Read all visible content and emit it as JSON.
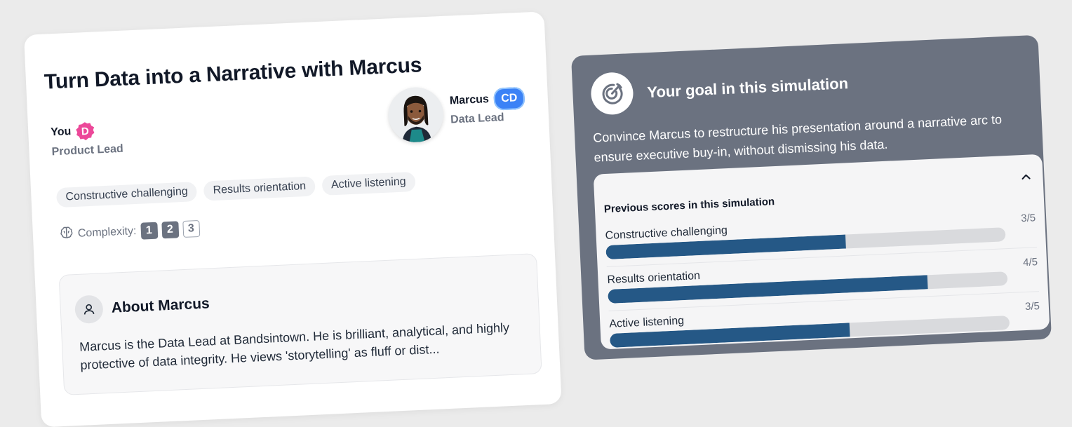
{
  "simulation": {
    "title": "Turn Data into a Narrative with Marcus",
    "you": {
      "name": "You",
      "badge": "D",
      "role": "Product Lead"
    },
    "partner": {
      "name": "Marcus",
      "badge": "CD",
      "role": "Data Lead"
    },
    "skills": [
      "Constructive challenging",
      "Results orientation",
      "Active listening"
    ],
    "complexity": {
      "label": "Complexity:",
      "levels": [
        "1",
        "2",
        "3"
      ],
      "current": 2
    }
  },
  "about": {
    "title": "About Marcus",
    "text": "Marcus is the Data Lead at Bandsintown. He is brilliant, analytical, and highly protective of data integrity. He views 'storytelling' as fluff or dist..."
  },
  "goal": {
    "title": "Your goal in this simulation",
    "text": "Convince Marcus to restructure his presentation around a narrative arc to ensure executive buy-in, without dismissing his data."
  },
  "scores": {
    "title": "Previous scores in this simulation",
    "items": [
      {
        "label": "Constructive challenging",
        "score": 3,
        "max": 5,
        "text": "3/5",
        "fill_percent": 60
      },
      {
        "label": "Results orientation",
        "score": 4,
        "max": 5,
        "text": "4/5",
        "fill_percent": 80
      },
      {
        "label": "Active listening",
        "score": 3,
        "max": 5,
        "text": "3/5",
        "fill_percent": 60
      }
    ]
  },
  "colors": {
    "you_badge": "#ec4899",
    "partner_badge": "#3b82f6",
    "goal_card": "#6b7280",
    "score_fill": "#255886"
  },
  "icons": {
    "complexity": "brain-icon",
    "about": "user-icon",
    "goal": "target-icon",
    "collapse": "chevron-up-icon"
  }
}
